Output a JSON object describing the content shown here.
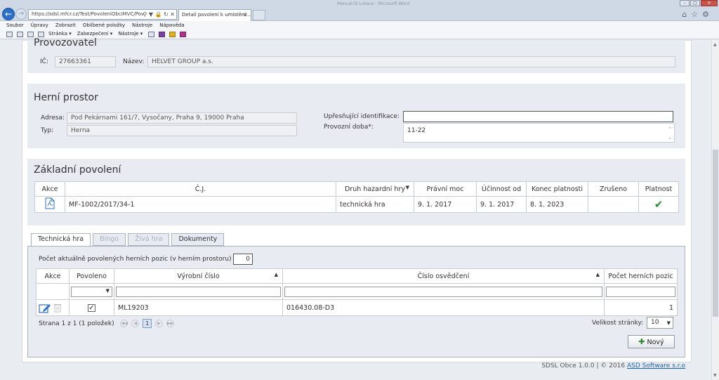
{
  "browser": {
    "address": "https://sdsl.mfcr.cz/Test/PovoleniObciMVC/PovoleniOb",
    "tab_title": "Detail povolení k umístění ...",
    "window_title": "Manual-IS Lokace - Microsoft Word",
    "menu": [
      "Soubor",
      "Úpravy",
      "Zobrazit",
      "Oblíbené položky",
      "Nástroje",
      "Nápověda"
    ],
    "toolbar": [
      "Stránka ▾",
      "Zabezpečení ▾",
      "Nástroje ▾"
    ]
  },
  "provozovatel": {
    "title": "Provozovatel",
    "ic_label": "IČ:",
    "ic_value": "27663361",
    "nazev_label": "Název:",
    "nazev_value": "HELVET GROUP a.s."
  },
  "herni_prostor": {
    "title": "Herní prostor",
    "adresa_label": "Adresa:",
    "adresa_value": "Pod Pekárnami 161/7, Vysočany, Praha 9, 19000 Praha",
    "typ_label": "Typ:",
    "typ_value": "Herna",
    "upresnujici_label": "Upřesňující identifikace:",
    "upresnujici_value": "",
    "provozni_doba_label": "Provozní doba*:",
    "provozni_doba_value": "11-22"
  },
  "zakladni_povoleni": {
    "title": "Základní povolení",
    "headers": [
      "Akce",
      "Č.J.",
      "Druh hazardní hry",
      "Právní moc",
      "Účinnost od",
      "Konec platnosti",
      "Zrušeno",
      "Platnost"
    ],
    "row": {
      "cj": "MF-1002/2017/34-1",
      "druh": "technická hra",
      "pravni_moc": "9. 1. 2017",
      "ucinnost_od": "9. 1. 2017",
      "konec_platnosti": "8. 1. 2023",
      "zruseno": ""
    }
  },
  "tabs": {
    "technicka": "Technická hra",
    "bingo": "Bingo",
    "ziva": "Živá hra",
    "dokumenty": "Dokumenty"
  },
  "technicka_hra": {
    "pocet_label": "Počet aktuálně povolených herních pozic (v herním prostoru)",
    "pocet_value": "0",
    "headers": [
      "Akce",
      "Povoleno",
      "Výrobní číslo",
      "Číslo osvědčení",
      "Počet herních pozic"
    ],
    "row": {
      "povoleno": true,
      "vyrobni_cislo": "ML19203",
      "cislo_osvedceni": "016430.08-D3",
      "pocet_pozic": "1"
    },
    "pager_text": "Strana 1 z 1 (1 položek)",
    "current_page": "1",
    "page_size_label": "Velikost stránky:",
    "page_size_value": "10",
    "new_button": "Nový"
  },
  "footer": {
    "text": "SDSL Obce 1.0.0  |  © 2016",
    "link": "ASD Software s.r.o"
  }
}
